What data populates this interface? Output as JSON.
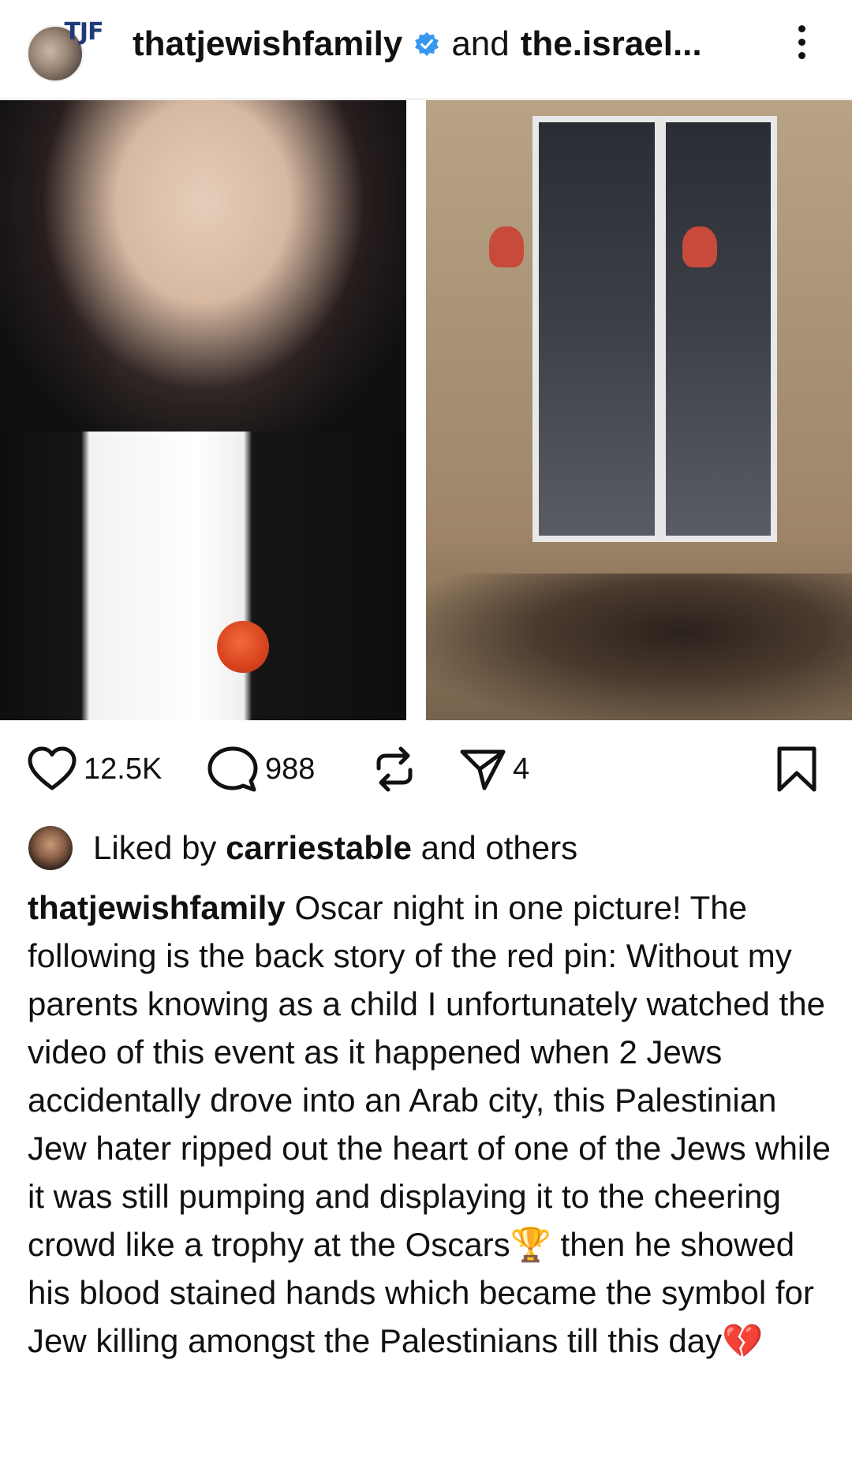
{
  "header": {
    "username": "thatjewishfamily",
    "verified": true,
    "and_text": "and",
    "collaborator": "the.israel...",
    "avatar_badge": "TJF"
  },
  "icons": {
    "more": "more-vertical-icon",
    "like": "heart-icon",
    "comment": "comment-icon",
    "repost": "repost-icon",
    "share": "send-icon",
    "save": "bookmark-icon",
    "verified": "verified-badge-icon"
  },
  "colors": {
    "verified_blue": "#3797f0",
    "text": "#111111"
  },
  "actions": {
    "likes": "12.5K",
    "comments": "988",
    "shares": "4"
  },
  "liked_by": {
    "prefix": "Liked by",
    "user": "carriestable",
    "suffix": "and others"
  },
  "caption": {
    "username": "thatjewishfamily",
    "text": "Oscar night in one picture! The following is the back story of the red pin: Without my parents knowing as a child I unfortunately watched the video of this event as it happened when 2 Jews accidentally drove into an Arab city, this Palestinian Jew hater ripped out the heart of one of the Jews while it was still pumping and displaying it to the cheering crowd like a trophy at the Oscars🏆 then he showed his blood stained hands which became the symbol for Jew killing amongst the Palestinians till this day💔"
  }
}
